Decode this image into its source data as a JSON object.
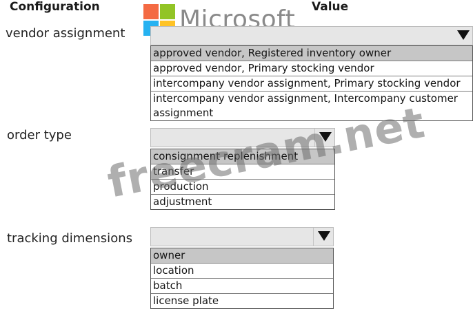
{
  "header": {
    "configuration": "Configuration",
    "value": "Value"
  },
  "logo": {
    "text": "Microsoft",
    "colors": [
      "#f25022",
      "#7fba00",
      "#00a4ef",
      "#ffb900"
    ]
  },
  "watermark": "freecram.net",
  "rows": [
    {
      "label": "vendor assignment",
      "selected": "",
      "options": [
        "approved vendor, Registered inventory owner",
        "approved vendor, Primary stocking vendor",
        "intercompany vendor assignment, Primary stocking vendor",
        "intercompany vendor assignment, Intercompany customer assignment"
      ],
      "highlighted_index": 0
    },
    {
      "label": "order type",
      "selected": "",
      "options": [
        "consignment replenishment",
        "transfer",
        "production",
        "adjustment"
      ],
      "highlighted_index": 0
    },
    {
      "label": "tracking dimensions",
      "selected": "",
      "options": [
        "owner",
        "location",
        "batch",
        "license plate"
      ],
      "highlighted_index": 0
    }
  ]
}
